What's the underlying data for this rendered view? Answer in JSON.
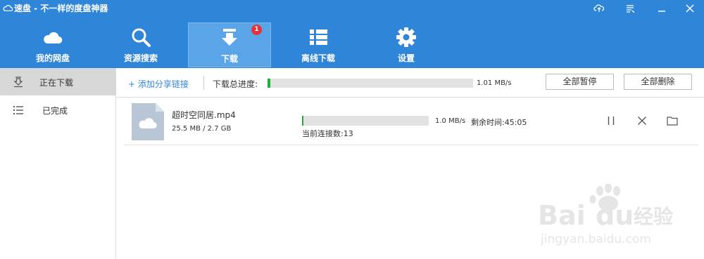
{
  "app": {
    "title": "速盘 - 不一样的度盘神器",
    "logo_icon": "cloud-icon"
  },
  "window_controls": [
    {
      "name": "cloud-sync-icon"
    },
    {
      "name": "skin-icon"
    },
    {
      "name": "minimize-icon"
    },
    {
      "name": "close-icon"
    }
  ],
  "nav": {
    "items": [
      {
        "label": "我的网盘",
        "icon": "cloud-icon"
      },
      {
        "label": "资源搜索",
        "icon": "search-icon"
      },
      {
        "label": "下载",
        "icon": "download-arrow-icon",
        "badge": "1",
        "active": true
      },
      {
        "label": "离线下载",
        "icon": "list-icon"
      },
      {
        "label": "设置",
        "icon": "gear-icon"
      }
    ]
  },
  "sidebar": {
    "items": [
      {
        "label": "正在下载",
        "icon": "download-tray-icon",
        "active": true
      },
      {
        "label": "已完成",
        "icon": "list-icon"
      }
    ]
  },
  "toolbar": {
    "add_link_label": "+ 添加分享链接",
    "total_progress_label": "下载总进度:",
    "total_progress_fraction": 0.01,
    "total_speed": "1.01 MB/s",
    "pause_all_label": "全部暂停",
    "delete_all_label": "全部删除"
  },
  "downloads": [
    {
      "file_name": "超时空同居.mp4",
      "file_size": "25.5 MB / 2.7 GB",
      "progress_fraction": 0.01,
      "speed": "1.0 MB/s",
      "remaining": "剩余时间:45:05",
      "connections": "当前连接数:13"
    }
  ],
  "watermark": {
    "text_main": "Baidu经验",
    "text_sub": "jingyan.baidu.com"
  },
  "colors": {
    "primary": "#2f86d8",
    "active_tab": "#5aa5e8",
    "progress": "#1fae3a",
    "badge": "#e8323a"
  }
}
